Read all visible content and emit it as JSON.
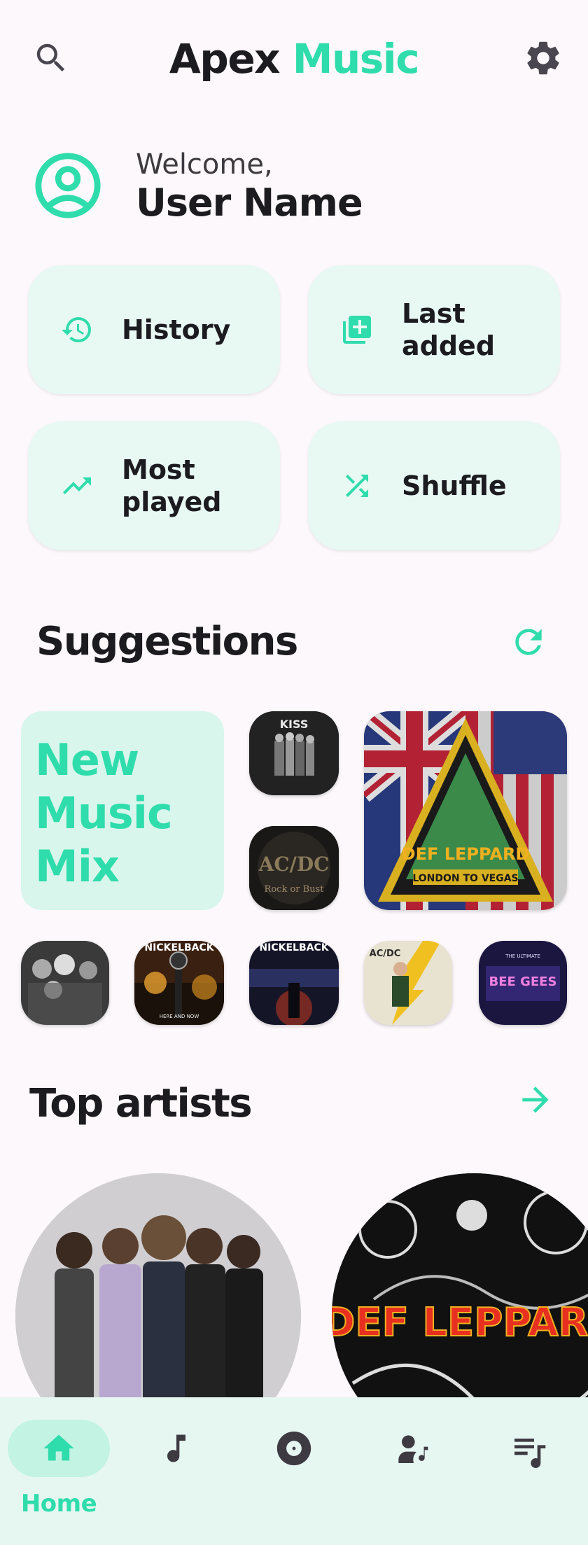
{
  "app": {
    "title_part1": "Apex ",
    "title_part2": "Music",
    "accent_color": "#2fdcab"
  },
  "header": {
    "search_icon": "search-icon",
    "settings_icon": "gear-icon"
  },
  "welcome": {
    "greeting": "Welcome,",
    "user_name": "User Name",
    "avatar_icon": "account-circle-icon"
  },
  "quick_actions": [
    {
      "label": "History",
      "icon": "history-icon"
    },
    {
      "label": "Last added",
      "icon": "library-add-icon"
    },
    {
      "label": "Most played",
      "icon": "trending-up-icon"
    },
    {
      "label": "Shuffle",
      "icon": "shuffle-icon"
    }
  ],
  "suggestions": {
    "title": "Suggestions",
    "refresh_icon": "refresh-icon",
    "mix_label": "New Music Mix",
    "albums": [
      {
        "artwork_text": "KISS",
        "kind": "album-cover"
      },
      {
        "artwork_text": "AC/DC",
        "artwork_subtext": "Rock or Bust",
        "kind": "album-cover"
      },
      {
        "artwork_text": "DEF LEPPARD",
        "artwork_subtext": "LONDON TO VEGAS",
        "kind": "album-cover"
      },
      {
        "artwork_text": "",
        "kind": "album-cover"
      },
      {
        "artwork_text": "NICKELBACK",
        "artwork_subtext": "HERE AND NOW",
        "kind": "album-cover"
      },
      {
        "artwork_text": "NICKELBACK",
        "kind": "album-cover"
      },
      {
        "artwork_text": "AC/DC",
        "kind": "album-cover"
      },
      {
        "artwork_text": "BEE GEES",
        "artwork_subtext": "THE ULTIMATE",
        "kind": "album-cover"
      }
    ]
  },
  "top_artists": {
    "title": "Top artists",
    "arrow_icon": "arrow-forward-icon",
    "artists": [
      {
        "kind": "band-photo"
      },
      {
        "artwork_text": "DEF LEPPARD",
        "kind": "artist-logo"
      }
    ]
  },
  "bottom_nav": [
    {
      "label": "Home",
      "icon": "home-icon",
      "active": true
    },
    {
      "label": "",
      "icon": "music-note-icon",
      "active": false
    },
    {
      "label": "",
      "icon": "album-icon",
      "active": false
    },
    {
      "label": "",
      "icon": "artist-icon",
      "active": false
    },
    {
      "label": "",
      "icon": "playlist-icon",
      "active": false
    }
  ]
}
